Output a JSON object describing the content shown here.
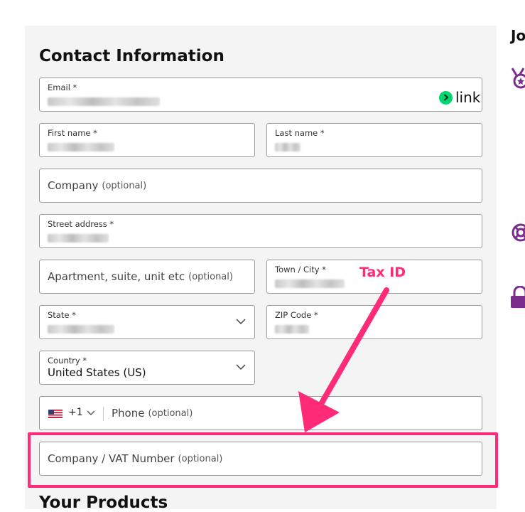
{
  "form": {
    "title": "Contact Information",
    "email_label": "Email *",
    "first_name_label": "First name *",
    "last_name_label": "Last name *",
    "company_placeholder": "Company",
    "company_optional": "(optional)",
    "street_label": "Street address *",
    "apartment_placeholder": "Apartment, suite, unit etc",
    "apartment_optional": "(optional)",
    "town_label": "Town / City *",
    "state_label": "State *",
    "zip_label": "ZIP Code *",
    "country_label": "Country *",
    "country_value": "United States (US)",
    "phone_code": "+1",
    "phone_placeholder": "Phone",
    "phone_optional": "(optional)",
    "vat_placeholder": "Company / VAT Number",
    "vat_optional": "(optional)",
    "next_section_title": "Your Products"
  },
  "link_badge": {
    "text": "link",
    "color": "#00d66f"
  },
  "annotation": {
    "text": "Tax ID",
    "color": "#ff2a78"
  },
  "right_column": {
    "heading": "Jo",
    "icons": [
      "badge-star-icon",
      "lifebuoy-icon",
      "lock-icon"
    ],
    "icon_color": "#7b2d8e"
  }
}
